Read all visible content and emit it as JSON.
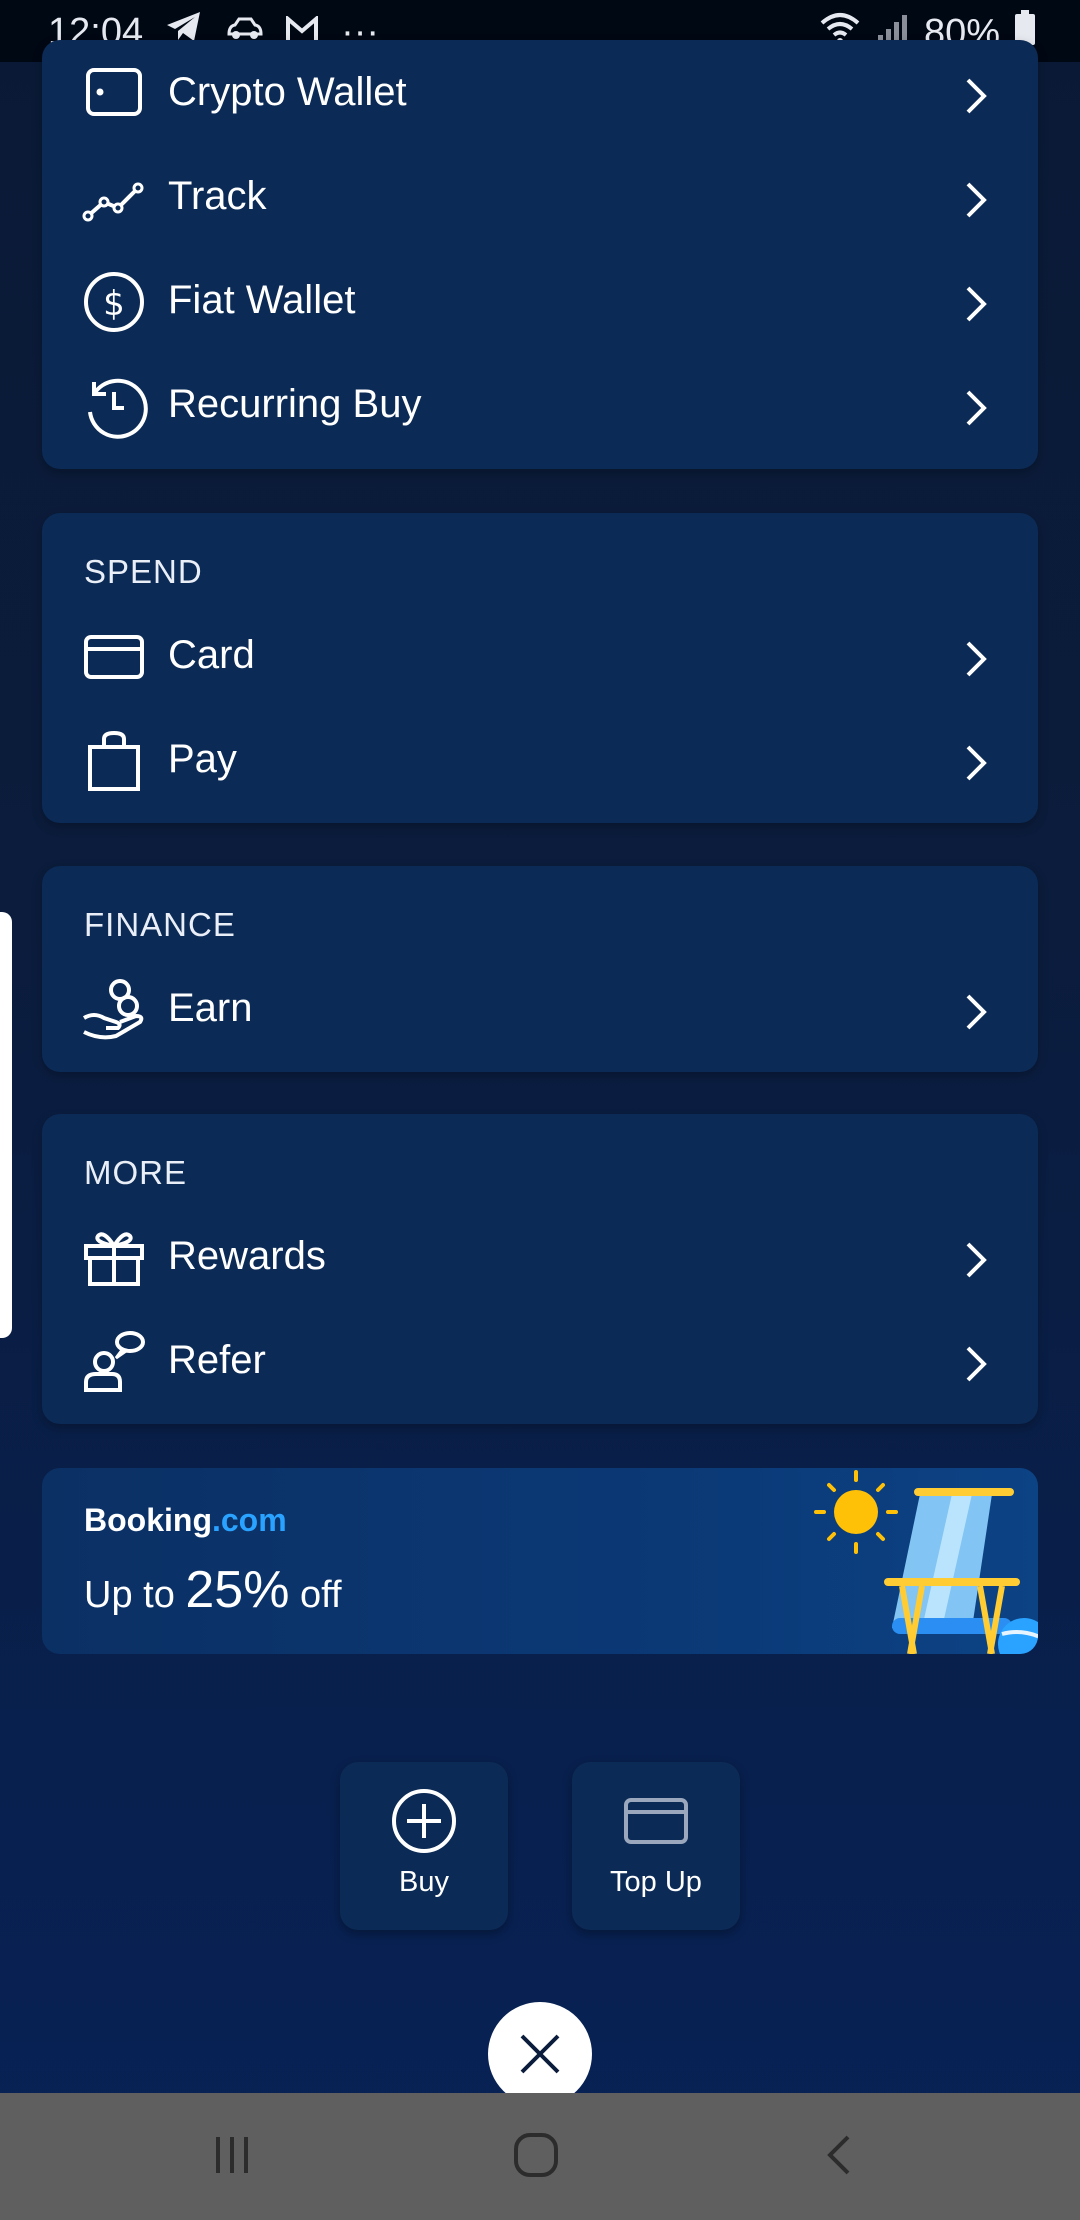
{
  "status": {
    "time": "12:04",
    "more": "···",
    "battery": "80%"
  },
  "menu_top": {
    "items": [
      {
        "label": "Crypto Wallet",
        "icon": "wallet-icon"
      },
      {
        "label": "Track",
        "icon": "track-icon"
      },
      {
        "label": "Fiat Wallet",
        "icon": "dollar-icon"
      },
      {
        "label": "Recurring Buy",
        "icon": "recurring-icon"
      }
    ]
  },
  "spend": {
    "title": "SPEND",
    "items": [
      {
        "label": "Card",
        "icon": "card-icon"
      },
      {
        "label": "Pay",
        "icon": "shopping-bag-icon"
      }
    ]
  },
  "finance": {
    "title": "FINANCE",
    "items": [
      {
        "label": "Earn",
        "icon": "earn-icon"
      }
    ]
  },
  "more": {
    "title": "MORE",
    "items": [
      {
        "label": "Rewards",
        "icon": "gift-icon"
      },
      {
        "label": "Refer",
        "icon": "refer-icon"
      }
    ]
  },
  "booking": {
    "brand_main": "Booking",
    "brand_suffix": ".com",
    "offer_prefix": "Up to",
    "offer_value": "25%",
    "offer_suffix": "off"
  },
  "actions": {
    "buy_label": "Buy",
    "topup_label": "Top Up"
  },
  "colors": {
    "background": "#0b1c3c",
    "card": "#0b2a55",
    "accent_blue": "#29a3ff",
    "sun": "#ffc107"
  }
}
